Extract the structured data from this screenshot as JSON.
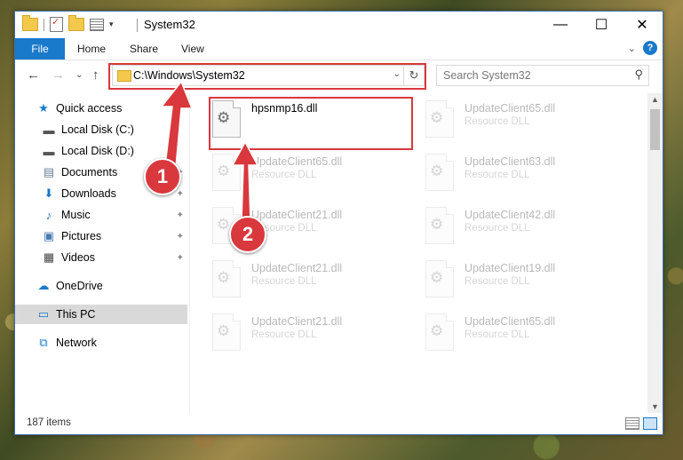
{
  "window": {
    "title": "System32",
    "tabs": [
      "File",
      "Home",
      "Share",
      "View"
    ],
    "address": "C:\\Windows\\System32",
    "search_placeholder": "Search System32",
    "status": "187 items"
  },
  "sidebar": {
    "items": [
      {
        "label": "Quick access",
        "icon": "star-icon"
      },
      {
        "label": "Local Disk (C:)",
        "icon": "drive-icon"
      },
      {
        "label": "Local Disk (D:)",
        "icon": "drive-icon"
      },
      {
        "label": "Documents",
        "icon": "documents-icon"
      },
      {
        "label": "Downloads",
        "icon": "download-icon"
      },
      {
        "label": "Music",
        "icon": "music-icon"
      },
      {
        "label": "Pictures",
        "icon": "pictures-icon"
      },
      {
        "label": "Videos",
        "icon": "videos-icon"
      },
      {
        "label": "OneDrive",
        "icon": "cloud-icon"
      },
      {
        "label": "This PC",
        "icon": "computer-icon"
      },
      {
        "label": "Network",
        "icon": "network-icon"
      }
    ]
  },
  "files": [
    {
      "name": "hpsnmp16.dll",
      "type": ""
    },
    {
      "name": "UpdateClient65.dll",
      "type": "Resource DLL"
    },
    {
      "name": "UpdateClient65.dll",
      "type": "Resource DLL"
    },
    {
      "name": "UpdateClient63.dll",
      "type": "Resource DLL"
    },
    {
      "name": "UpdateClient21.dll",
      "type": "Resource DLL"
    },
    {
      "name": "UpdateClient42.dll",
      "type": "Resource DLL"
    },
    {
      "name": "UpdateClient21.dll",
      "type": "Resource DLL"
    },
    {
      "name": "UpdateClient19.dll",
      "type": "Resource DLL"
    },
    {
      "name": "UpdateClient21.dll",
      "type": "Resource DLL"
    },
    {
      "name": "UpdateClient65.dll",
      "type": "Resource DLL"
    }
  ],
  "annotations": {
    "step1": "1",
    "step2": "2",
    "color": "#d9383d"
  }
}
